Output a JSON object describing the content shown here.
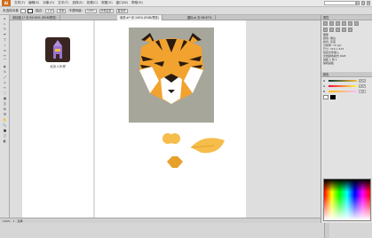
{
  "menubar": {
    "logo": "Ai",
    "items": [
      "文件(F)",
      "编辑(E)",
      "对象(O)",
      "文字(T)",
      "选择(S)",
      "效果(C)",
      "视图(V)",
      "窗口(W)",
      "帮助(H)"
    ],
    "search_placeholder": "",
    "winctl": [
      "—",
      "□",
      "×"
    ]
  },
  "ctrlbar": {
    "selection_label": "未选择对象",
    "stroke_label": "描边:",
    "stroke_value": "1 pt",
    "style_label": "基本",
    "opacity_label": "不透明度:",
    "opacity_value": "100%",
    "doc_settings": "文档设置",
    "prefs": "首选项"
  },
  "tabs": [
    {
      "label": "未标题-1* @ 84.94% (RGB/预览)",
      "active": false
    },
    {
      "label": "老虎.ai* @ 100% (RGB/预览)",
      "active": true
    },
    {
      "label": "图标.ai @ 66.67%",
      "active": false
    }
  ],
  "toolbar": [
    "▸",
    "▹",
    "✎",
    "✒",
    "T",
    "/",
    "▭",
    "✏",
    "⌒",
    "◐",
    "↻",
    "⤢",
    "◇",
    "✂",
    "⬚",
    "▦",
    "◫",
    "⊞",
    "☰",
    "✋",
    "🔍",
    "■",
    "□",
    "◧"
  ],
  "artboard": {
    "icon_label": "北京人乐祥"
  },
  "statusbar": {
    "zoom": "100%",
    "page": "1",
    "mode": "选择"
  },
  "rpanel": {
    "header": "属性",
    "lines": [
      "图像",
      "颜色: 黑白",
      "模式: 灰度",
      "分辨率: 72 ppi",
      "尺寸: 216 x 224",
      "",
      "链接文件嵌入",
      "文档颜色模式 RGB",
      "画板 1 的 1",
      "编辑画板"
    ],
    "color_header": "颜色",
    "sliders": [
      {
        "name": "R",
        "value": "252"
      },
      {
        "name": "G",
        "value": "187"
      },
      {
        "name": "B",
        "value": "58"
      }
    ]
  },
  "colors": {
    "tiger_orange": "#f2a22e",
    "tiger_dark": "#2a1a12",
    "shape_yellow": "#f5bd4a",
    "shape_orange": "#e7a02a",
    "canvas_bg": "#a6a69a"
  }
}
